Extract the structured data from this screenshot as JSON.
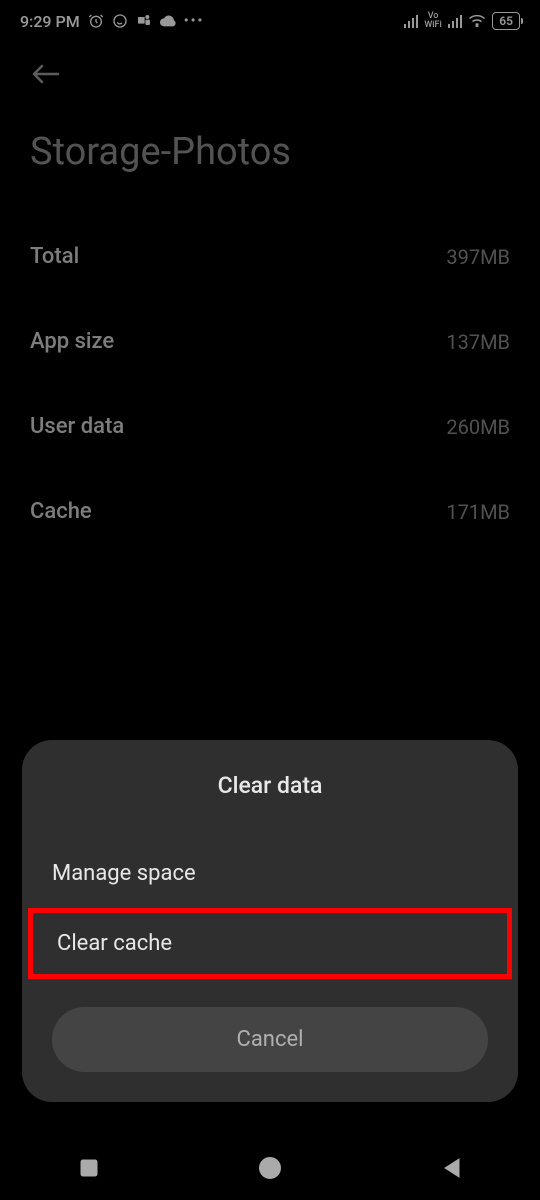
{
  "status": {
    "time": "9:29 PM",
    "battery": "65",
    "vowifi_top": "Vo",
    "vowifi_bottom": "WiFi"
  },
  "page": {
    "title": "Storage-Photos"
  },
  "storage": {
    "rows": [
      {
        "label": "Total",
        "value": "397MB"
      },
      {
        "label": "App size",
        "value": "137MB"
      },
      {
        "label": "User data",
        "value": "260MB"
      },
      {
        "label": "Cache",
        "value": "171MB"
      }
    ]
  },
  "dialog": {
    "title": "Clear data",
    "manage_space": "Manage space",
    "clear_cache": "Clear cache",
    "cancel": "Cancel"
  }
}
